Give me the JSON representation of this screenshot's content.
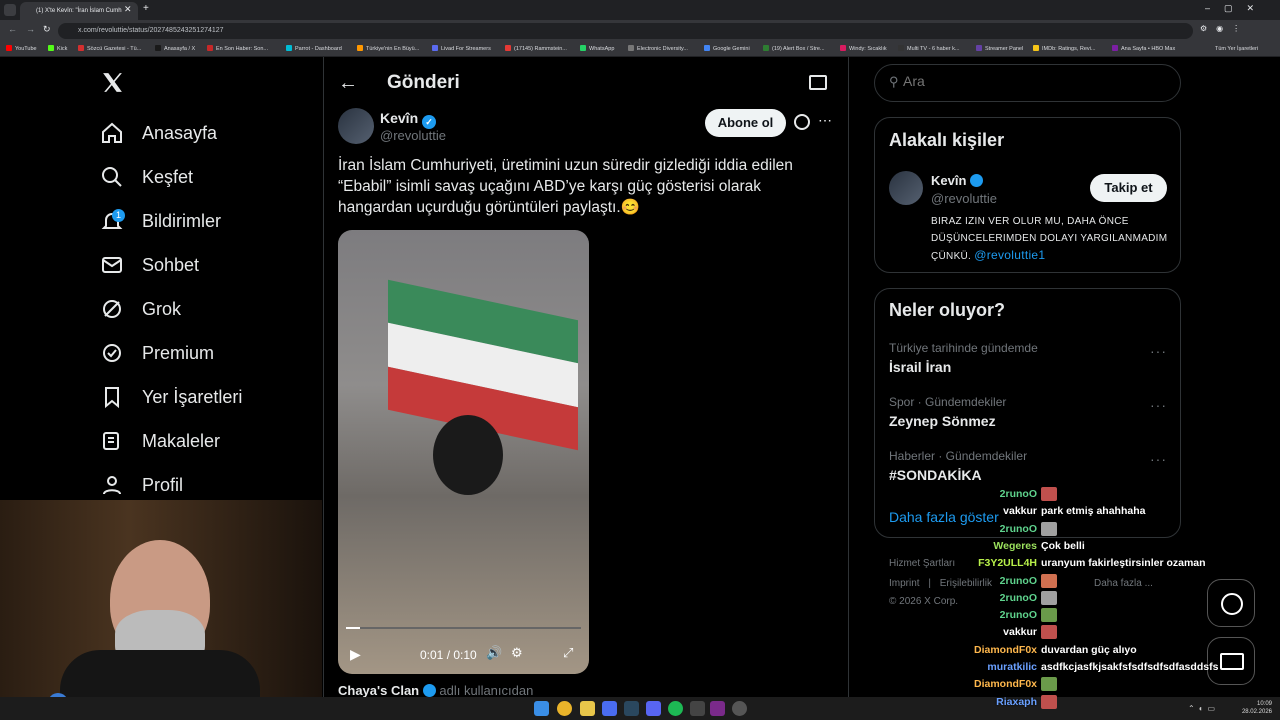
{
  "browser": {
    "tab_title": "(1) X'te Kevîn: \"İran İslam Cumh",
    "url": "x.com/revoluttie/status/2027485243251274127",
    "bookmarks": [
      "YouTube",
      "Kick",
      "Sözcü Gazetesi - Tü...",
      "Anasayfa / X",
      "En Son Haber: Son...",
      "Parrot - Dashboard",
      "Türkiye'nin En Büyü...",
      "Livad For Streamers",
      "(17145) Rammstein...",
      "WhatsApp",
      "Electronic Diversity...",
      "Google Gemini",
      "(19) Alert Box / Stre...",
      "Windy: Sıcaklık",
      "Multi TV - 6 haber k...",
      "Streamer Panel",
      "IMDb: Ratings, Revi...",
      "Ana Sayfa • HBO Max"
    ],
    "all_bookmarks": "Tüm Yer İşaretleri"
  },
  "nav": {
    "items": [
      "Anasayfa",
      "Keşfet",
      "Bildirimler",
      "Sohbet",
      "Grok",
      "Premium",
      "Yer İşaretleri",
      "Makaleler",
      "Profil"
    ],
    "badge": "1"
  },
  "post": {
    "header": "Gönderi",
    "author": "Kevîn",
    "handle": "@revoluttie",
    "subscribe": "Abone ol",
    "text": "İran İslam Cumhuriyeti, üretimini uzun süredir gizlediği iddia edilen “Ebabil” isimli savaş uçağını ABD’ye karşı güç gösterisi olarak hangardan uçurduğu görüntüleri paylaştı.😊",
    "video_time": "0:01 / 0:10",
    "quote_author": "Chaya's Clan",
    "quote_note": "adlı kullanıcıdan"
  },
  "search": {
    "placeholder": "Ara"
  },
  "related": {
    "title": "Alakalı kişiler",
    "name": "Kevîn",
    "handle": "@revoluttie",
    "follow": "Takip et",
    "bio": "BIRAZ IZIN VER OLUR MU, DAHA ÖNCE DÜŞÜNCELERIMDEN DOLAYI YARGILANMADIM ÇÜNKÜ.",
    "bio_link": "@revoluttie1"
  },
  "trends": {
    "title": "Neler oluyor?",
    "items": [
      {
        "context": "Türkiye tarihinde gündemde",
        "name": "İsrail İran"
      },
      {
        "context": "Spor · Gündemdekiler",
        "name": "Zeynep Sönmez"
      },
      {
        "context": "Haberler · Gündemdekiler",
        "name": "#SONDAKİKA"
      }
    ],
    "more": "Daha fazla göster"
  },
  "footer": {
    "links": [
      "Hizmet Şartları",
      "Imprint",
      "Erişilebilirlik",
      "Daha fazla ..."
    ],
    "copyright": "© 2026 X Corp."
  },
  "chat": [
    {
      "user": "2runoO",
      "color": "#5fd38d",
      "msg": ""
    },
    {
      "user": "vakkur",
      "color": "#ffffff",
      "msg": "park etmiş ahahhaha"
    },
    {
      "user": "2runoO",
      "color": "#5fd38d",
      "msg": ""
    },
    {
      "user": "Wegeres",
      "color": "#9be15d",
      "msg": "Çok belli"
    },
    {
      "user": "F3Y2ULL4H",
      "color": "#b8f04a",
      "msg": "uranyum fakirleştirsinler ozaman"
    },
    {
      "user": "2runoO",
      "color": "#5fd38d",
      "msg": ""
    },
    {
      "user": "2runoO",
      "color": "#5fd38d",
      "msg": ""
    },
    {
      "user": "2runoO",
      "color": "#5fd38d",
      "msg": ""
    },
    {
      "user": "vakkur",
      "color": "#ffffff",
      "msg": ""
    },
    {
      "user": "DiamondF0x",
      "color": "#ffb84d",
      "msg": "duvardan güç alıyo"
    },
    {
      "user": "muratkilic",
      "color": "#6aa0ff",
      "msg": "asdfkcjasfkjsakfsfsdfsdfsdfasddsfs"
    },
    {
      "user": "DiamondF0x",
      "color": "#ffb84d",
      "msg": ""
    },
    {
      "user": "Riaxaph",
      "color": "#6aa0ff",
      "msg": ""
    }
  ],
  "clock": {
    "time": "10:09",
    "date": "28.02.2026"
  }
}
